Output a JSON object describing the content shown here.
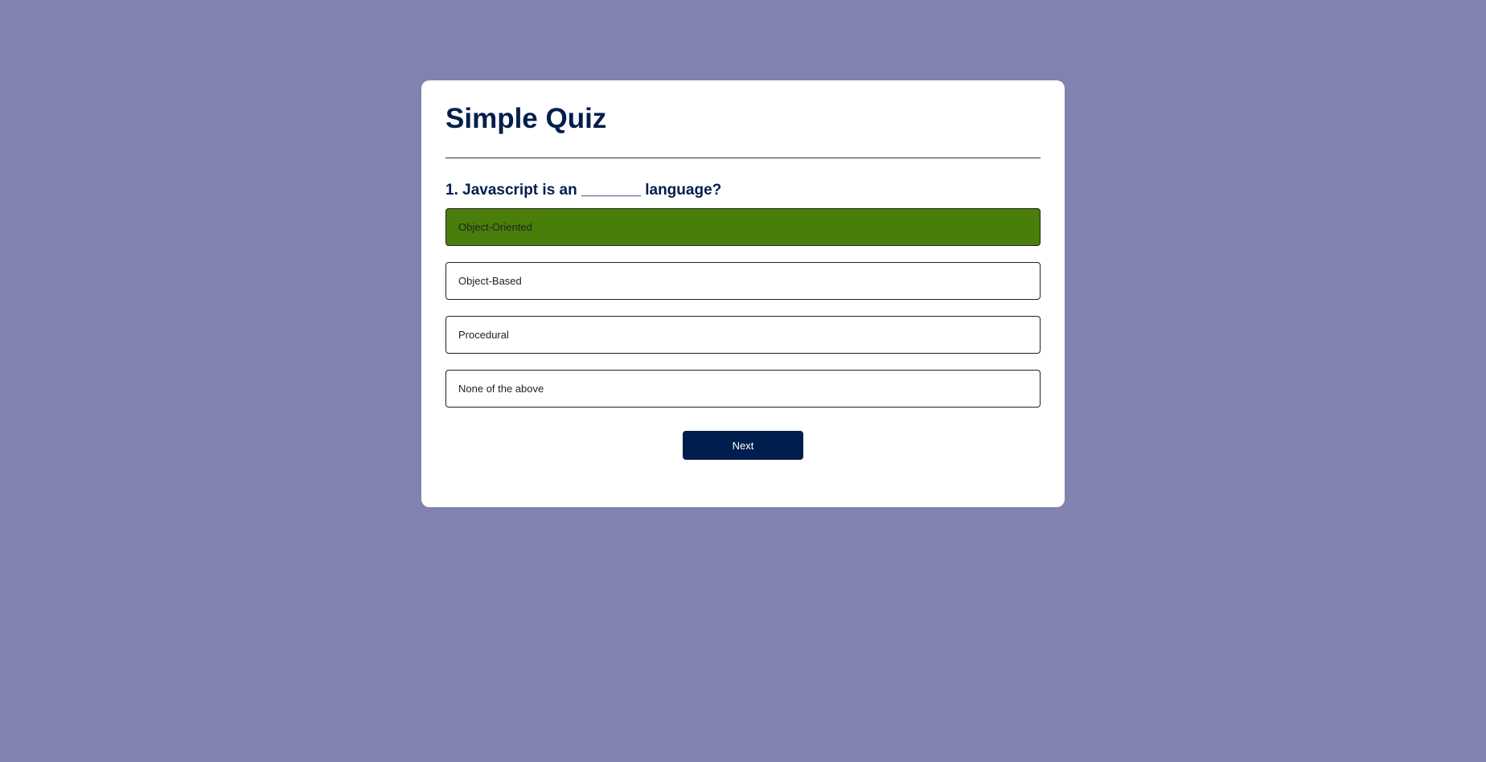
{
  "quiz": {
    "title": "Simple Quiz",
    "question": "1. Javascript is an _______ language?",
    "options": [
      {
        "label": "Object-Oriented",
        "state": "correct"
      },
      {
        "label": "Object-Based"
      },
      {
        "label": "Procedural"
      },
      {
        "label": "None of the above"
      }
    ],
    "next_label": "Next"
  },
  "colors": {
    "background": "#8282b0",
    "primary": "#001e4d",
    "correct": "#4a7e0b"
  }
}
